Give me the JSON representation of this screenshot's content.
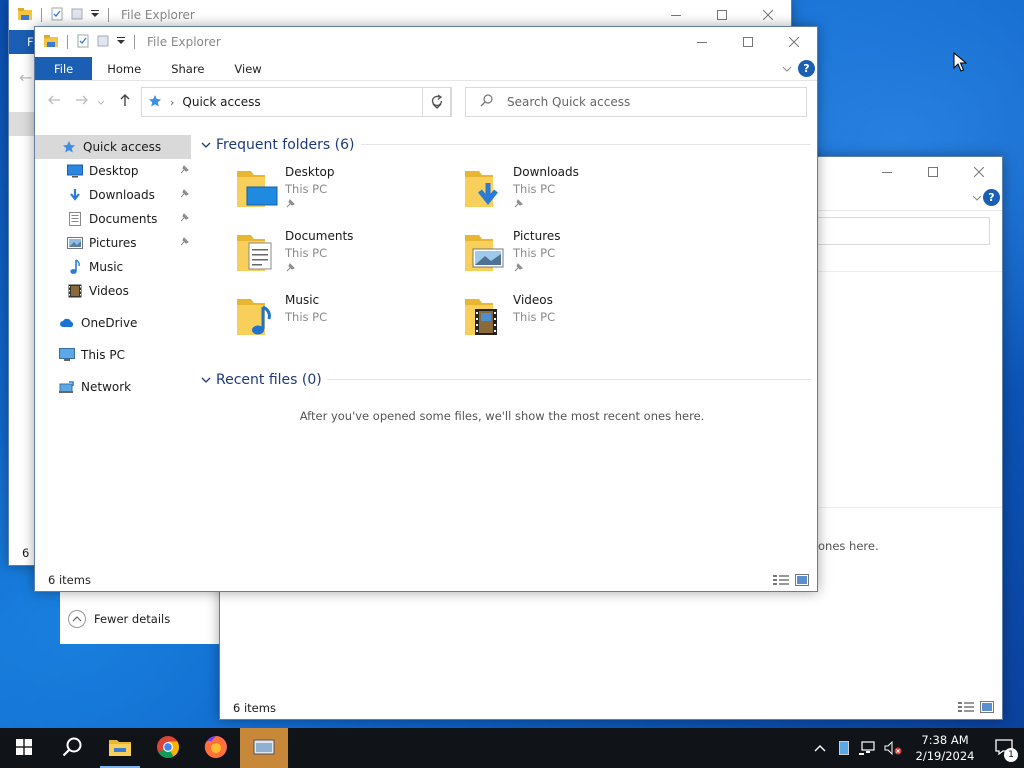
{
  "app": {
    "title": "File Explorer"
  },
  "ribbon": {
    "file": "File",
    "home": "Home",
    "share": "Share",
    "view": "View",
    "help": "?"
  },
  "back_window": {
    "tab_initial": "F",
    "status_prefix": "6 i"
  },
  "right_window": {
    "status": "6 items",
    "recent_tail": "ones here."
  },
  "details_pane": {
    "fewer_details": "Fewer details"
  },
  "address": {
    "location": "Quick access"
  },
  "search": {
    "placeholder": "Search Quick access"
  },
  "nav": {
    "quick_access": "Quick access",
    "desktop": "Desktop",
    "downloads": "Downloads",
    "documents": "Documents",
    "pictures": "Pictures",
    "music": "Music",
    "videos": "Videos",
    "onedrive": "OneDrive",
    "this_pc": "This PC",
    "network": "Network"
  },
  "frequent": {
    "header": "Frequent folders (6)",
    "items": [
      {
        "name": "Desktop",
        "location": "This PC"
      },
      {
        "name": "Downloads",
        "location": "This PC"
      },
      {
        "name": "Documents",
        "location": "This PC"
      },
      {
        "name": "Pictures",
        "location": "This PC"
      },
      {
        "name": "Music",
        "location": "This PC"
      },
      {
        "name": "Videos",
        "location": "This PC"
      }
    ]
  },
  "recent": {
    "header": "Recent files (0)",
    "empty_message": "After you've opened some files, we'll show the most recent ones here."
  },
  "status": {
    "item_count": "6 items"
  },
  "tray": {
    "time": "7:38 AM",
    "date": "2/19/2024",
    "notification_count": "1"
  },
  "colors": {
    "accent": "#1a5fb4",
    "selection": "#cce4f7",
    "folder": "#f4c542",
    "taskbar": "#101318"
  }
}
